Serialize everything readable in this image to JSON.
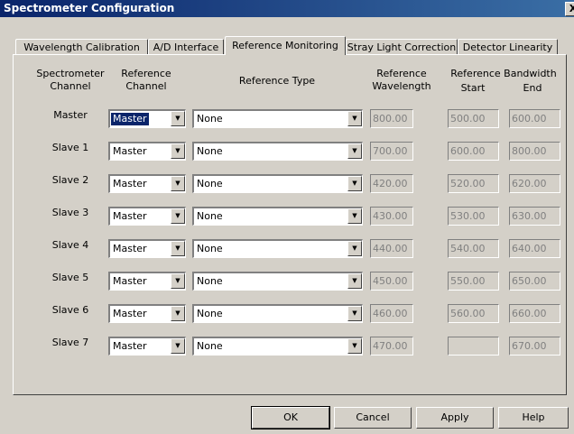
{
  "window": {
    "title": "Spectrometer Configuration",
    "close_glyph": "X"
  },
  "tabs": [
    {
      "label": "Wavelength Calibration",
      "active": false
    },
    {
      "label": "A/D Interface",
      "active": false
    },
    {
      "label": "Reference Monitoring",
      "active": true
    },
    {
      "label": "Stray Light Correction",
      "active": false
    },
    {
      "label": "Detector Linearity",
      "active": false
    }
  ],
  "headers": {
    "spectrometer_channel": [
      "Spectrometer",
      "Channel"
    ],
    "reference_channel": [
      "Reference",
      "Channel"
    ],
    "reference_type": "Reference Type",
    "reference_wavelength": [
      "Reference",
      "Wavelength"
    ],
    "reference_bandwidth": "Reference Bandwidth",
    "start": "Start",
    "end": "End"
  },
  "rows": [
    {
      "channel": "Master",
      "ref_channel": "Master",
      "ref_type": "None",
      "wavelength": "800.00",
      "start": "500.00",
      "end": "600.00"
    },
    {
      "channel": "Slave 1",
      "ref_channel": "Master",
      "ref_type": "None",
      "wavelength": "700.00",
      "start": "600.00",
      "end": "800.00"
    },
    {
      "channel": "Slave 2",
      "ref_channel": "Master",
      "ref_type": "None",
      "wavelength": "420.00",
      "start": "520.00",
      "end": "620.00"
    },
    {
      "channel": "Slave 3",
      "ref_channel": "Master",
      "ref_type": "None",
      "wavelength": "430.00",
      "start": "530.00",
      "end": "630.00"
    },
    {
      "channel": "Slave 4",
      "ref_channel": "Master",
      "ref_type": "None",
      "wavelength": "440.00",
      "start": "540.00",
      "end": "640.00"
    },
    {
      "channel": "Slave 5",
      "ref_channel": "Master",
      "ref_type": "None",
      "wavelength": "450.00",
      "start": "550.00",
      "end": "650.00"
    },
    {
      "channel": "Slave 6",
      "ref_channel": "Master",
      "ref_type": "None",
      "wavelength": "460.00",
      "start": "560.00",
      "end": "660.00"
    },
    {
      "channel": "Slave 7",
      "ref_channel": "Master",
      "ref_type": "None",
      "wavelength": "470.00",
      "start": "",
      "end": "670.00"
    }
  ],
  "buttons": {
    "ok": "OK",
    "cancel": "Cancel",
    "apply": "Apply",
    "help": "Help"
  },
  "icons": {
    "dropdown": "dropdown-arrow-icon"
  },
  "colors": {
    "titlebar": "#0a246a",
    "face": "#d4d0c8",
    "selection": "#0a246a",
    "disabled_text": "#808080"
  }
}
